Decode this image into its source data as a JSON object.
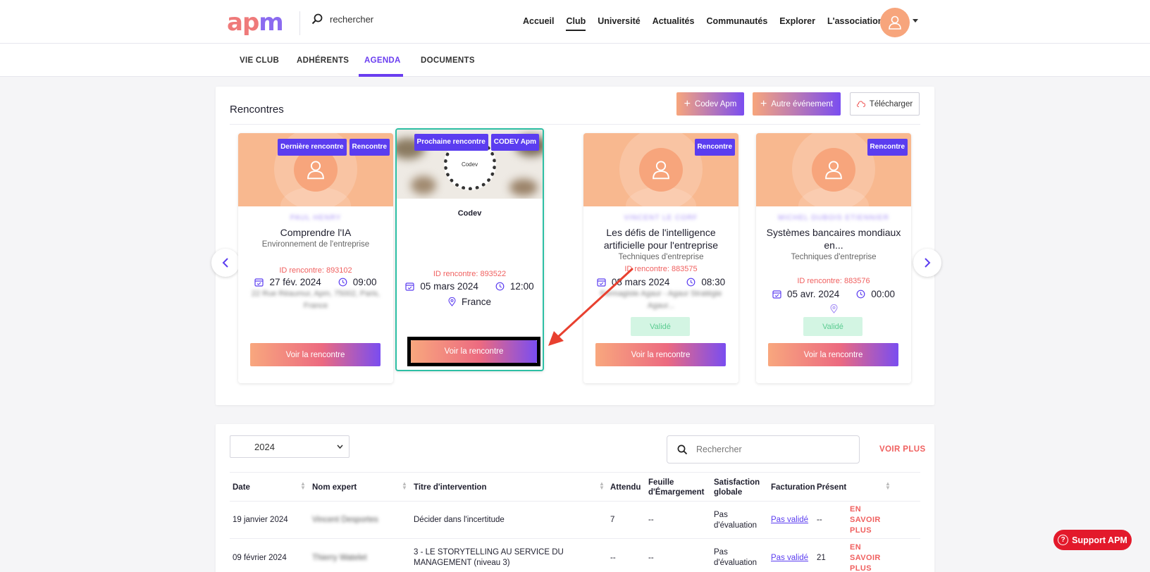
{
  "header": {
    "logo": {
      "a": "ap",
      "m": "m"
    },
    "search_placeholder": "rechercher",
    "nav": [
      "Accueil",
      "Club",
      "Université",
      "Actualités",
      "Communautés",
      "Explorer",
      "L'association"
    ],
    "active_nav": "Club"
  },
  "subnav": {
    "tabs": [
      "VIE CLUB",
      "ADHÉRENTS",
      "AGENDA",
      "DOCUMENTS"
    ],
    "active_tab": "AGENDA"
  },
  "rencontres": {
    "title": "Rencontres",
    "buttons": {
      "codev": "Codev Apm",
      "autre": "Autre événement",
      "telecharger": "Télécharger"
    },
    "cards": [
      {
        "badges": [
          "Dernière rencontre",
          "Rencontre"
        ],
        "expert": "PAUL HENRY",
        "title": "Comprendre l'IA",
        "subtitle": "Environnement de l'entreprise",
        "id": "ID rencontre: 893102",
        "date": "27 fév. 2024",
        "time": "09:00",
        "location": "22 Rue Réaumur, Apm, 75002, Paris, France",
        "button": "Voir la rencontre"
      },
      {
        "badges": [
          "Prochaine rencontre",
          "CODEV Apm"
        ],
        "image_label": "Codev",
        "title": "Codev",
        "id": "ID rencontre: 893522",
        "date": "05 mars 2024",
        "time": "12:00",
        "location": "France",
        "button": "Voir la rencontre"
      },
      {
        "badges": [
          "Rencontre"
        ],
        "expert": "VINCENT LE CORF",
        "title": "Les défis de l'intelligence artificielle pour l'entreprise",
        "subtitle": "Techniques d'entreprise",
        "id": "ID rencontre: 883575",
        "date": "08 mars 2024",
        "time": "08:30",
        "location": "Formagiste Agaur - Agaur Stratégie Agaur...",
        "status": "Validé",
        "button": "Voir la rencontre"
      },
      {
        "badges": [
          "Rencontre"
        ],
        "expert": "MICHEL DUBOIS ETIENNIER",
        "title": "Systèmes bancaires mondiaux en...",
        "subtitle": "Techniques d'entreprise",
        "id": "ID rencontre: 883576",
        "date": "05 avr. 2024",
        "time": "00:00",
        "status": "Validé",
        "button": "Voir la rencontre"
      }
    ]
  },
  "table": {
    "year": "2024",
    "search_placeholder": "Rechercher",
    "voir_plus": "VOIR PLUS",
    "columns": [
      "Date",
      "Nom expert",
      "Titre d'intervention",
      "Attendu",
      "Feuille d'Émargement",
      "Satisfaction globale",
      "Facturation",
      "Présent"
    ],
    "rows": [
      {
        "date": "19 janvier 2024",
        "expert": "Vincent Desportes",
        "titre": "Décider dans l'incertitude",
        "attendu": "7",
        "feuille": "--",
        "satisfaction": "Pas d'évaluation",
        "facturation": "Pas validé",
        "present": "--",
        "action": "EN SAVOIR PLUS"
      },
      {
        "date": "09 février 2024",
        "expert": "Thierry Watelet",
        "titre": "3 - LE STORYTELLING AU SERVICE DU MANAGEMENT (niveau 3)",
        "attendu": "--",
        "feuille": "--",
        "satisfaction": "Pas d'évaluation",
        "facturation": "Pas validé",
        "present": "21",
        "action": "EN SAVOIR PLUS"
      }
    ]
  },
  "support": {
    "label": "Support APM"
  },
  "colors": {
    "accent": "#5b3df0",
    "coral": "#f0605f",
    "peach": "#f7a57c",
    "highlight": "#2dbfa4",
    "support": "#e3192b"
  }
}
